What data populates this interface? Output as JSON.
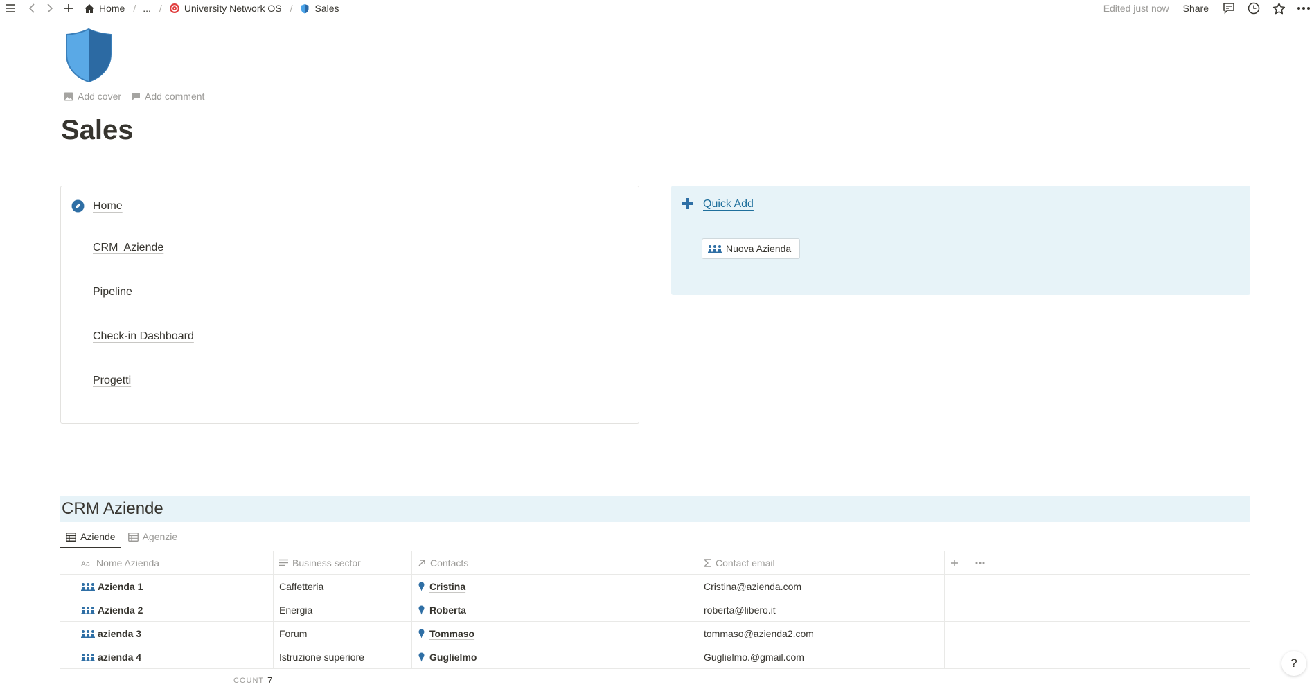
{
  "topbar": {
    "breadcrumbs": [
      {
        "label": "Home",
        "icon": "house-icon"
      },
      {
        "label": "..."
      },
      {
        "label": "University Network OS",
        "icon": "target-icon"
      },
      {
        "label": "Sales",
        "icon": "shield-icon"
      }
    ],
    "edited": "Edited just now",
    "share": "Share"
  },
  "page": {
    "icon": "shield-icon",
    "add_cover": "Add cover",
    "add_comment": "Add comment",
    "title": "Sales"
  },
  "nav_box": {
    "links": [
      {
        "label": "Home",
        "icon": "compass-icon"
      },
      {
        "label": "CRM  Aziende"
      },
      {
        "label": "Pipeline"
      },
      {
        "label": "Check-in Dashboard"
      },
      {
        "label": "Progetti"
      }
    ]
  },
  "quick_add": {
    "title": "Quick Add",
    "button_label": "Nuova Azienda",
    "accent": "#1f6f9c"
  },
  "database": {
    "title": "CRM Aziende",
    "tabs": [
      {
        "label": "Aziende",
        "active": true
      },
      {
        "label": "Agenzie",
        "active": false
      }
    ],
    "columns": [
      {
        "label": "Nome Azienda",
        "icon": "aa-text-icon"
      },
      {
        "label": "Business sector",
        "icon": "lines-icon"
      },
      {
        "label": "Contacts",
        "icon": "arrow-up-right-icon"
      },
      {
        "label": "Contact email",
        "icon": "sigma-icon"
      }
    ],
    "rows": [
      {
        "name": "Azienda 1",
        "sector": "Caffetteria",
        "contact": "Cristina",
        "email": "Cristina@azienda.com"
      },
      {
        "name": "Azienda 2",
        "sector": "Energia",
        "contact": "Roberta",
        "email": "roberta@libero.it"
      },
      {
        "name": "azienda 3",
        "sector": "Forum",
        "contact": "Tommaso",
        "email": "tommaso@azienda2.com"
      },
      {
        "name": "azienda 4",
        "sector": "Istruzione superiore",
        "contact": "Guglielmo",
        "email": "Guglielmo.@gmail.com"
      }
    ],
    "count_label": "COUNT",
    "count_value": "7"
  },
  "help": {
    "label": "?"
  },
  "colors": {
    "text": "#37352f",
    "muted": "#9b9a97",
    "blue_bg": "#e7f3f8",
    "icon_blue": "#2f6fa5"
  }
}
